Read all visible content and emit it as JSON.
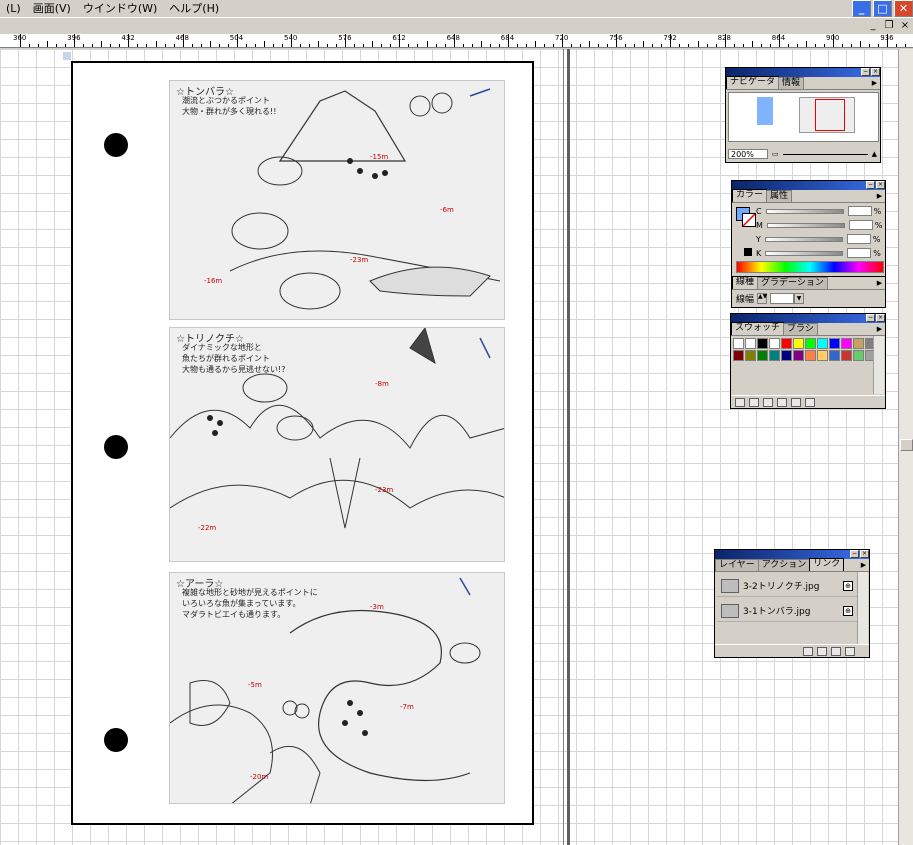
{
  "menubar": {
    "items": [
      "(L)",
      "画面(V)",
      "ウインドウ(W)",
      "ヘルプ(H)"
    ],
    "doc_min": "_",
    "doc_restore": "❐",
    "doc_close": "×"
  },
  "ruler": {
    "labels": [
      "360",
      "396",
      "432",
      "468",
      "504",
      "540",
      "576",
      "612",
      "648",
      "684",
      "720",
      "756",
      "792",
      "828",
      "864",
      "900",
      "936"
    ]
  },
  "navigator": {
    "tabs": [
      "ナビゲータ",
      "情報"
    ],
    "zoom": "200%"
  },
  "color": {
    "tabs": [
      "カラー",
      "属性"
    ],
    "channels": [
      "C",
      "M",
      "Y",
      "K"
    ],
    "percent": "%"
  },
  "stroke": {
    "tabs": [
      "線種",
      "グラデーション"
    ],
    "label": "線幅"
  },
  "swatches": {
    "tabs": [
      "スウォッチ",
      "ブラシ"
    ],
    "colors": [
      "#ffffff",
      "#ffffff",
      "#000000",
      "#ffffff",
      "#ff0000",
      "#ffff00",
      "#00ff00",
      "#00ffff",
      "#0000ff",
      "#ff00ff",
      "#c8a060",
      "#808080",
      "#800000",
      "#808000",
      "#008000",
      "#008080",
      "#000080",
      "#800080",
      "#ff8040",
      "#ffcc66",
      "#3366cc",
      "#cc3333",
      "#66cc66",
      "#a0a0a0"
    ]
  },
  "layers": {
    "tabs": [
      "レイヤー",
      "アクション",
      "リンク"
    ],
    "links": [
      "3-2トリノクチ.jpg",
      "3-1トンバラ.jpg"
    ]
  },
  "photos": {
    "photo1": {
      "title": "☆トンバラ☆",
      "lines": [
        "潮流とぶつかるポイント",
        "大物・群れが多く現れる!!"
      ],
      "depths": [
        "-15m",
        "-6m",
        "-23m",
        "-16m"
      ]
    },
    "photo2": {
      "title": "☆トリノクチ☆",
      "lines": [
        "ダイナミックな地形と",
        "魚たちが群れるポイント",
        "大物も通るから見逃せない!?"
      ],
      "depths": [
        "-8m",
        "-23m",
        "-22m"
      ]
    },
    "photo3": {
      "title": "☆アーラ☆",
      "lines": [
        "複雑な地形と砂地が見えるポイントに",
        "いろいろな魚が集まっています。",
        "マダラトビエイも通ります。"
      ],
      "depths": [
        "-3m",
        "-5m",
        "-7m",
        "-20m"
      ]
    }
  }
}
